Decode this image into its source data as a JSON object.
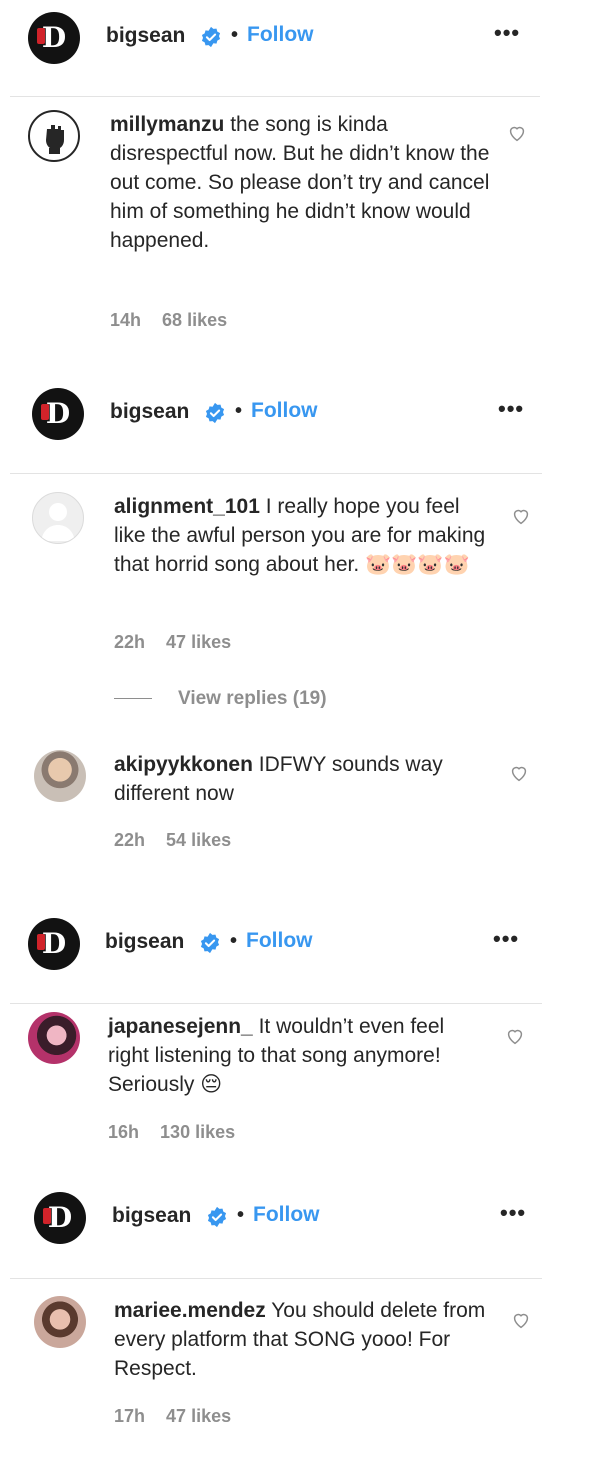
{
  "accent_color": "#3897f0",
  "posts": [
    {
      "header": {
        "username": "bigsean",
        "separator": "•",
        "follow": "Follow",
        "more": "•••"
      },
      "comments": [
        {
          "username": "millymanzu",
          "text": "the song is kinda disrespectful now. But he didn’t know the out come. So please don’t try and cancel him of something he didn’t know would happened.",
          "time": "14h",
          "likes": "68 likes",
          "avatar_icon": "raised-fist-icon"
        }
      ]
    },
    {
      "header": {
        "username": "bigsean",
        "separator": "•",
        "follow": "Follow",
        "more": "•••"
      },
      "comments": [
        {
          "username": "alignment_101",
          "text": "I really hope you feel like the awful person you are for making that horrid song about her. 🐷🐷🐷🐷",
          "time": "22h",
          "likes": "47 likes",
          "avatar_icon": "default-avatar-icon",
          "view_replies": "View replies (19)"
        },
        {
          "username": "akipyykkonen",
          "text": "IDFWY sounds way different now",
          "time": "22h",
          "likes": "54 likes",
          "avatar_icon": "user-photo-icon"
        }
      ]
    },
    {
      "header": {
        "username": "bigsean",
        "separator": "•",
        "follow": "Follow",
        "more": "•••"
      },
      "comments": [
        {
          "username": "japanesejenn_",
          "text": "It wouldn’t even feel right listening to that song anymore! Seriously 😔",
          "time": "16h",
          "likes": "130 likes",
          "avatar_icon": "user-photo-icon"
        }
      ]
    },
    {
      "header": {
        "username": "bigsean",
        "separator": "•",
        "follow": "Follow",
        "more": "•••"
      },
      "comments": [
        {
          "username": "mariee.mendez",
          "text": "You should delete from every platform that SONG yooo! For Respect.",
          "time": "17h",
          "likes": "47 likes",
          "avatar_icon": "user-photo-icon"
        }
      ]
    }
  ]
}
